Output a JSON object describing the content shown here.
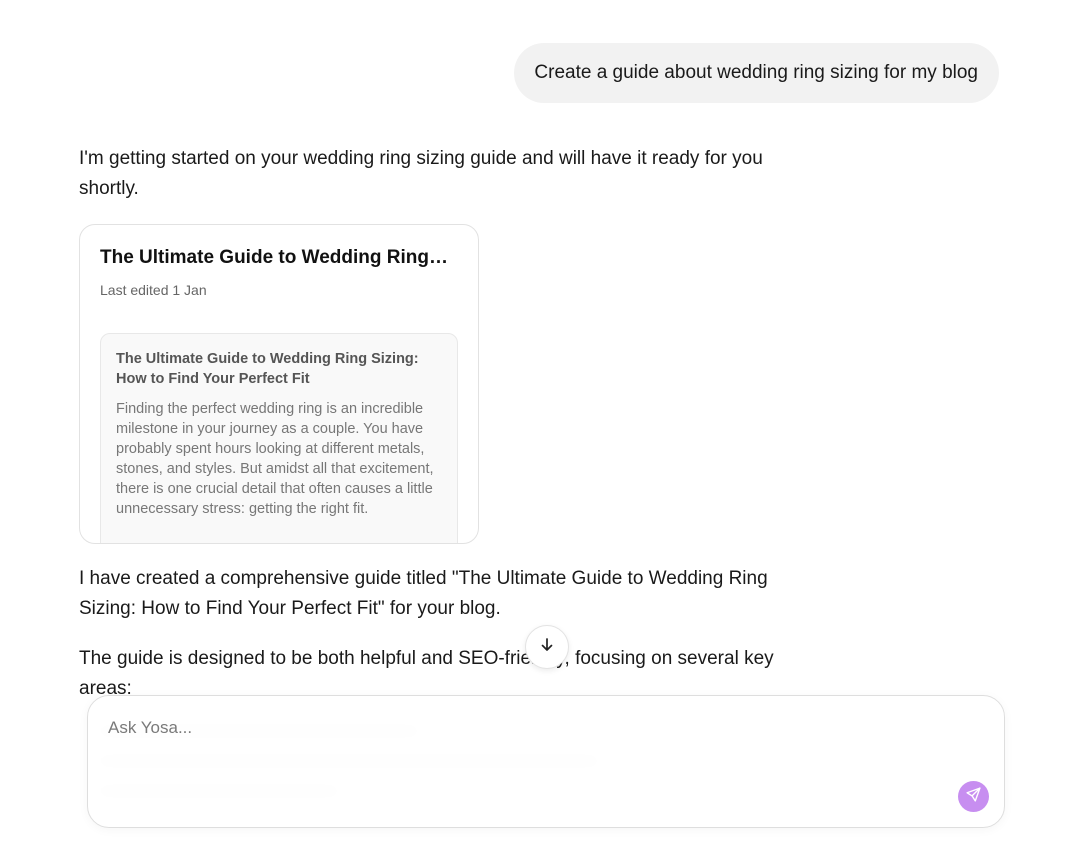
{
  "user_message": "Create a guide about wedding ring sizing for my blog",
  "assistant": {
    "intro": "I'm getting started on your wedding ring sizing guide and will have it ready for you shortly.",
    "doc_card": {
      "title": "The Ultimate Guide to Wedding Ring Sizing: How to Find Your Perfect Fit",
      "edited": "Last edited 1 Jan",
      "preview_heading": "The Ultimate Guide to Wedding Ring Sizing: How to Find Your Perfect Fit",
      "preview_body": "Finding the perfect wedding ring is an incredible milestone in your journey as a couple. You have probably spent hours looking at different metals, stones, and styles. But amidst all that excitement, there is one crucial detail that often causes a little unnecessary stress: getting the right fit."
    },
    "summary": "I have created a comprehensive guide titled \"The Ultimate Guide to Wedding Ring Sizing: How to Find Your Perfect Fit\" for your blog.",
    "focus_intro": "The guide is designed to be both helpful and SEO-friendly, focusing on several key areas:"
  },
  "composer": {
    "placeholder": "Ask Yosa..."
  },
  "icons": {
    "scroll_down": "arrow-down-icon",
    "send": "send-icon"
  },
  "colors": {
    "user_bubble_bg": "#f2f2f2",
    "send_button": "#c78ef0"
  }
}
